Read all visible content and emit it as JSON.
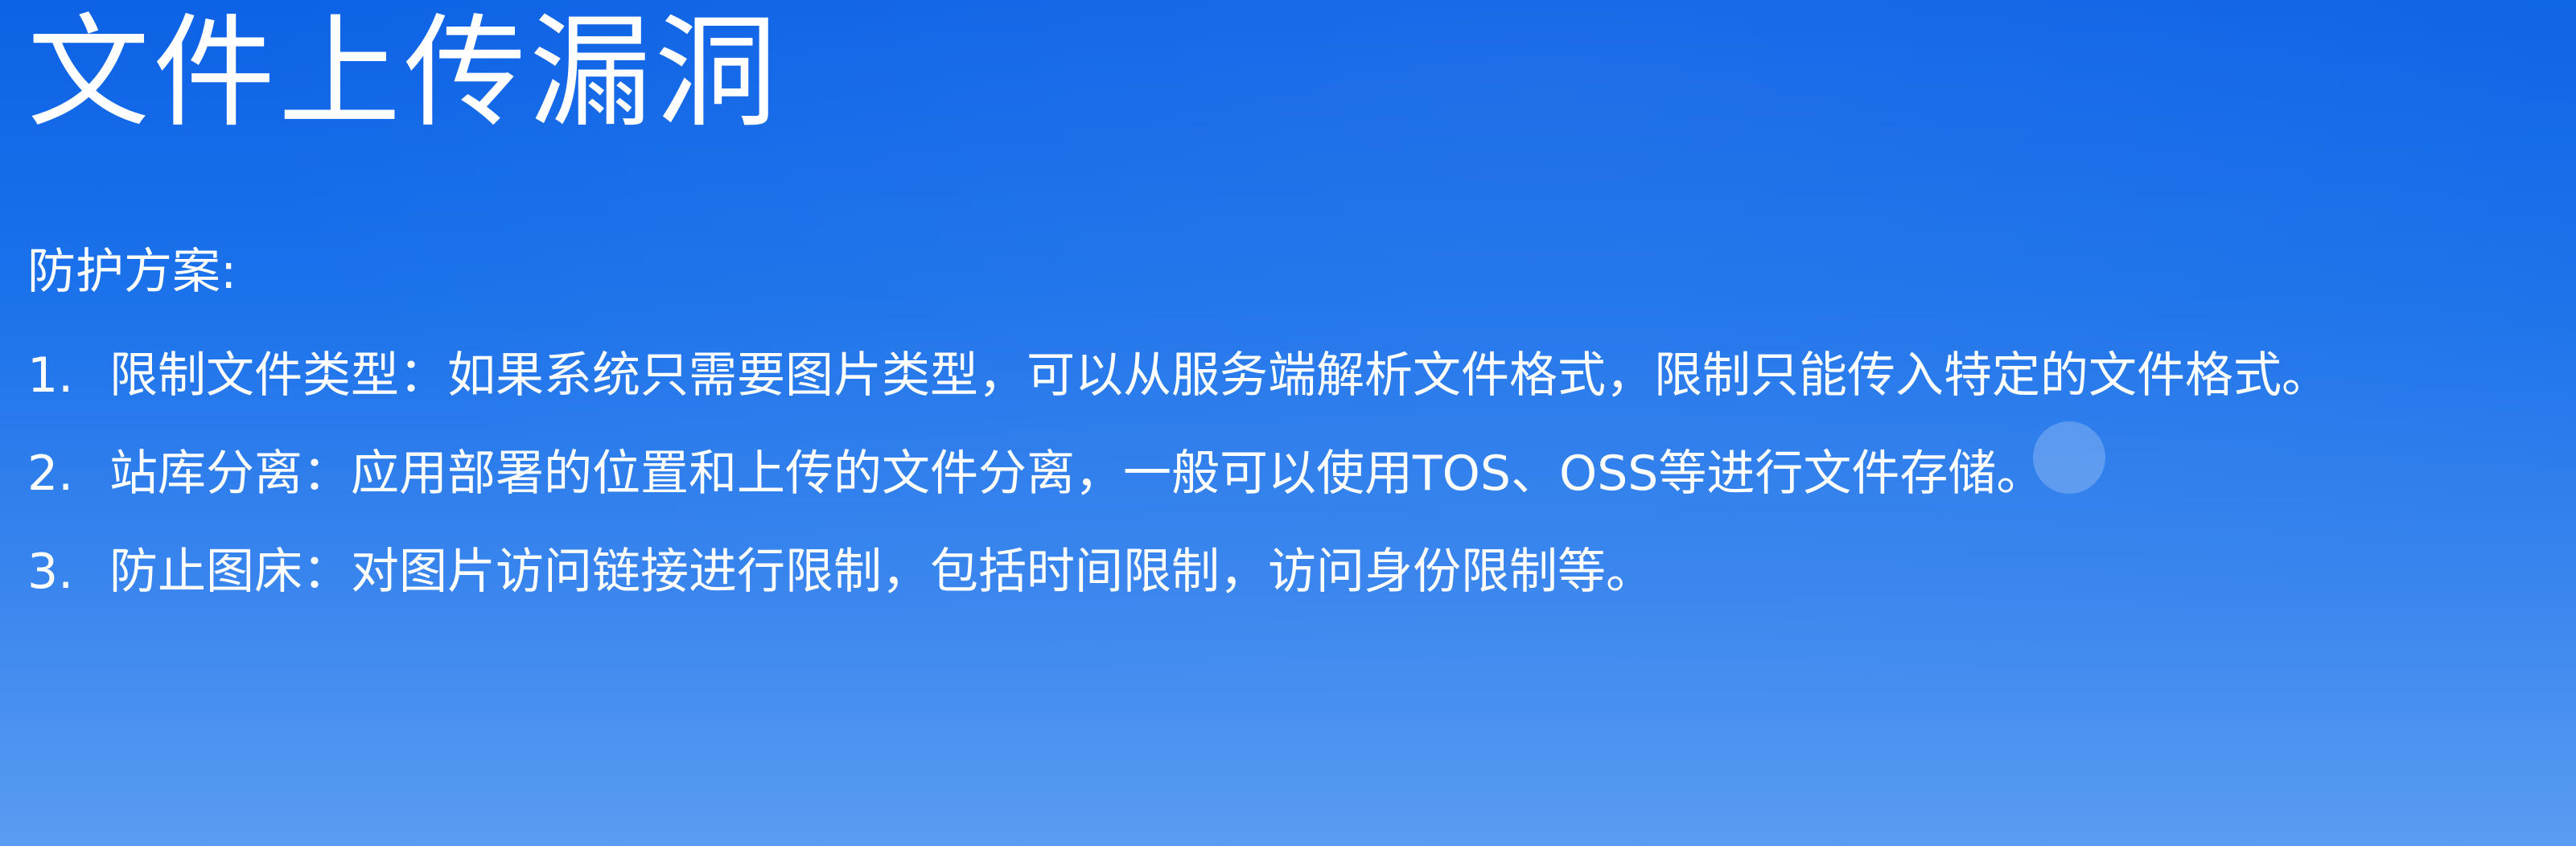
{
  "slide": {
    "title": "文件上传漏洞",
    "intro": "防护方案:",
    "items": [
      {
        "number": "1.",
        "text": "限制文件类型：如果系统只需要图片类型，可以从服务端解析文件格式，限制只能传入特定的文件格式。"
      },
      {
        "number": "2.",
        "text": "站库分离：应用部署的位置和上传的文件分离，一般可以使用TOS、OSS等进行文件存储。"
      },
      {
        "number": "3.",
        "text": "防止图床：对图片访问链接进行限制，包括时间限制，访问身份限制等。"
      }
    ]
  },
  "colors": {
    "background_top": "#0d62e6",
    "background_bottom": "#5a9cf2",
    "text": "#ffffff"
  }
}
